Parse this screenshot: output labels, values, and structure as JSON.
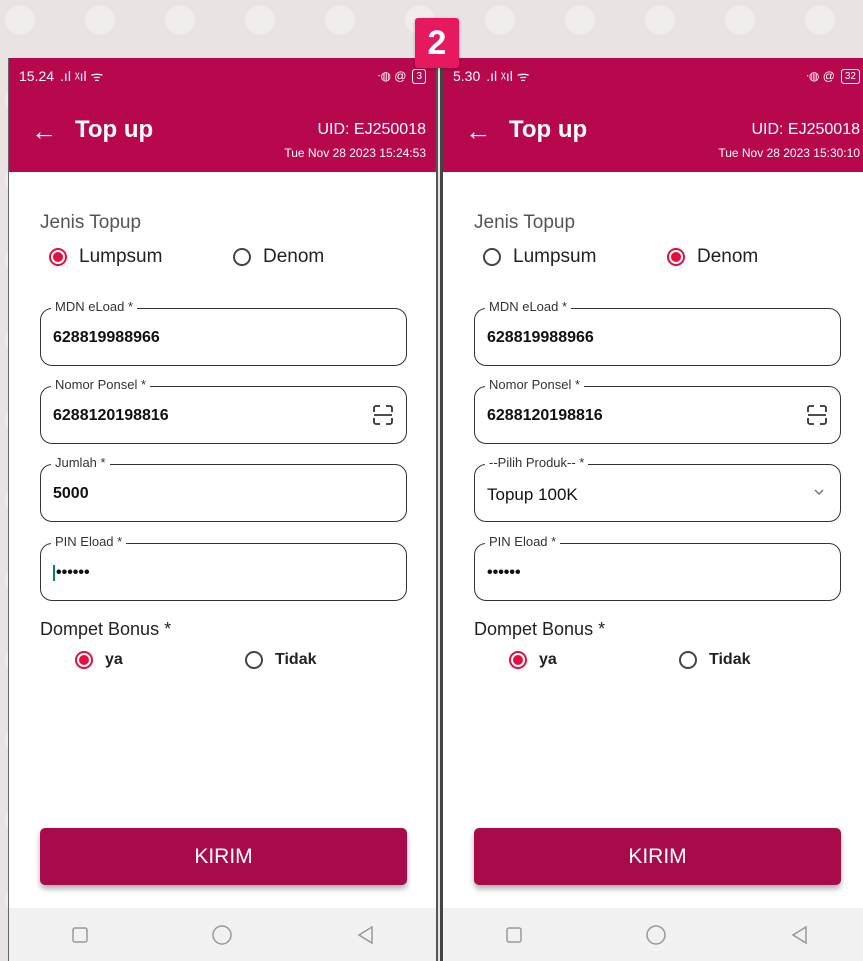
{
  "step_badge": "2",
  "colors": {
    "brand": "#b8084d",
    "button": "#a90a4a",
    "radio_accent": "#e0103f"
  },
  "left": {
    "status": {
      "time": "15.24",
      "signal": ".ıl ᵡıl ᯤ",
      "icons_right": "ᐧ◍ @",
      "battery": "3"
    },
    "appbar": {
      "title": "Top up",
      "uid": "UID: EJ250018",
      "datetime": "Tue Nov 28 2023 15:24:53"
    },
    "jenis_label": "Jenis Topup",
    "radio_lumpsum": "Lumpsum",
    "radio_denom": "Denom",
    "selected_jenis": "Lumpsum",
    "mdn": {
      "label": "MDN eLoad *",
      "value": "628819988966"
    },
    "nomor": {
      "label": "Nomor Ponsel *",
      "value": "6288120198816"
    },
    "jumlah": {
      "label": "Jumlah *",
      "value": "5000"
    },
    "pin": {
      "label": "PIN Eload *",
      "value": "••••••"
    },
    "bonus_label": "Dompet Bonus *",
    "bonus_ya": "ya",
    "bonus_tidak": "Tidak",
    "kirim": "KIRIM"
  },
  "right": {
    "status": {
      "time": "5.30",
      "signal": ".ıl ᵡıl ᯤ",
      "icons_right": "ᐧ◍ @",
      "battery": "32"
    },
    "appbar": {
      "title": "Top up",
      "uid": "UID: EJ250018",
      "datetime": "Tue Nov 28 2023 15:30:10"
    },
    "jenis_label": "Jenis Topup",
    "radio_lumpsum": "Lumpsum",
    "radio_denom": "Denom",
    "selected_jenis": "Denom",
    "mdn": {
      "label": "MDN eLoad *",
      "value": "628819988966"
    },
    "nomor": {
      "label": "Nomor Ponsel *",
      "value": "6288120198816"
    },
    "produk": {
      "label": "--Pilih Produk-- *",
      "value": "Topup 100K"
    },
    "pin": {
      "label": "PIN Eload *",
      "value": "••••••"
    },
    "bonus_label": "Dompet Bonus *",
    "bonus_ya": "ya",
    "bonus_tidak": "Tidak",
    "kirim": "KIRIM"
  }
}
